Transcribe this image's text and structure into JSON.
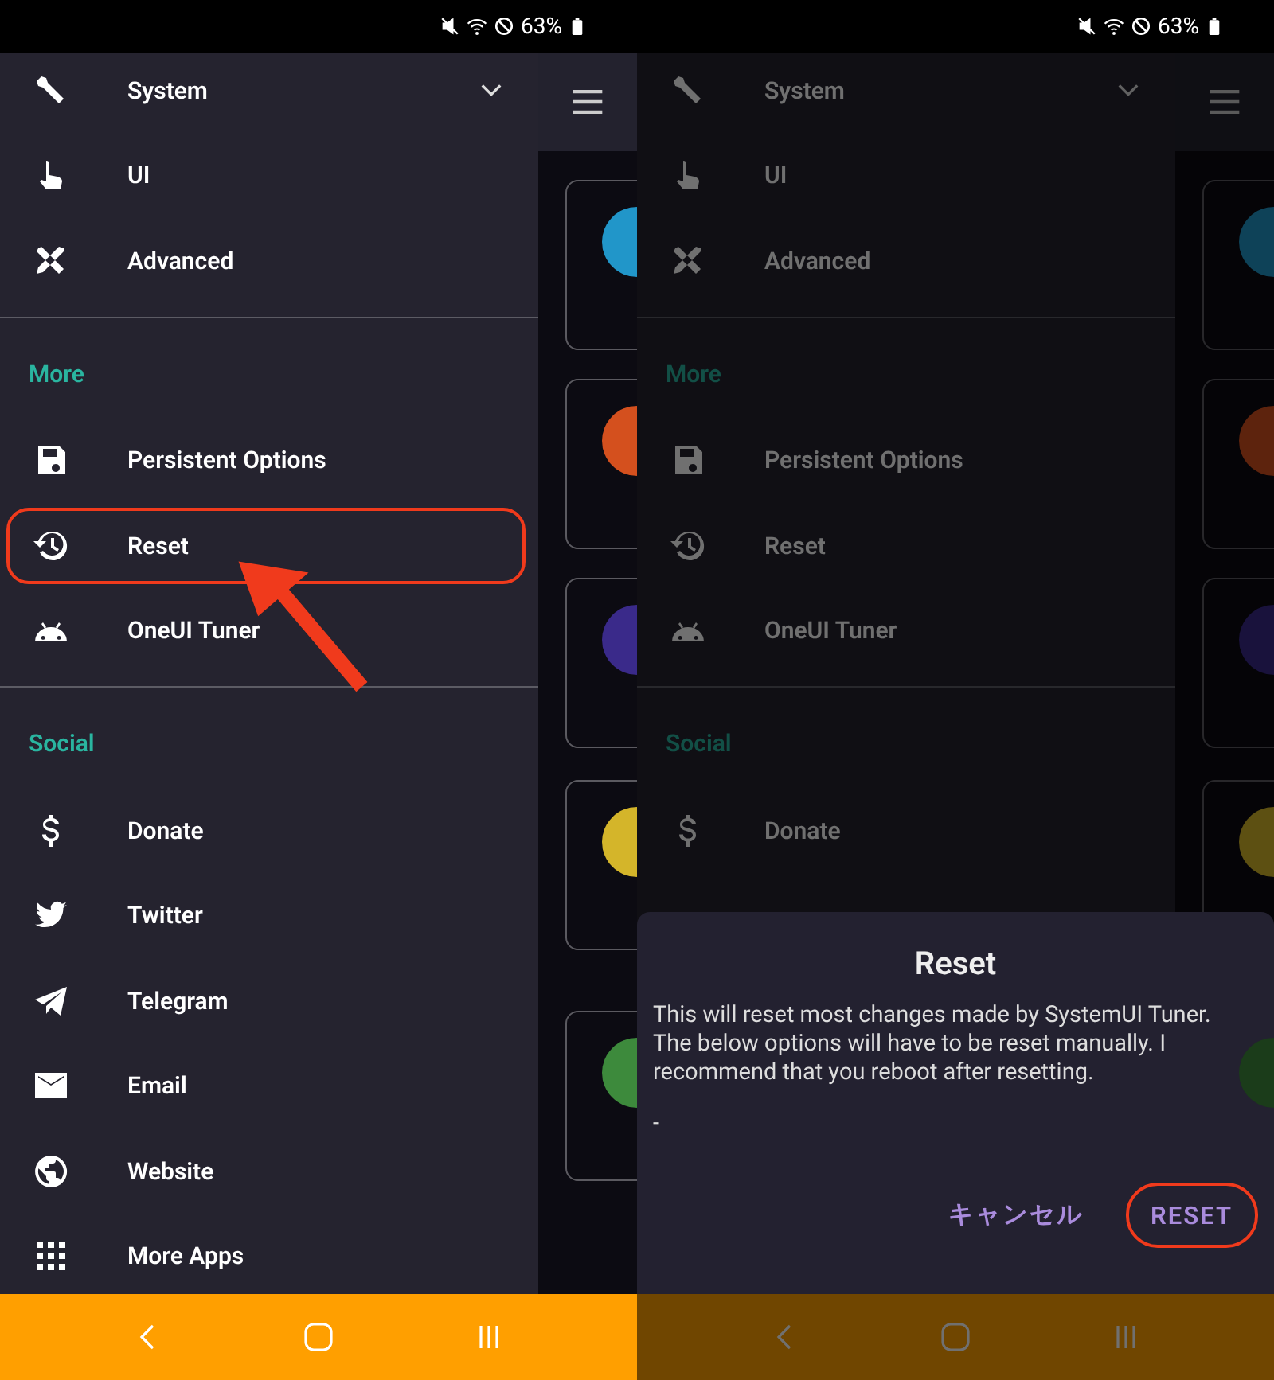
{
  "screens": [
    {
      "status": {
        "battery": "63%"
      },
      "cards": [
        {
          "color": "#2196c9"
        },
        {
          "color": "#d4501e"
        },
        {
          "color": "#3a2a8a"
        },
        {
          "color": "#d4b52a"
        },
        {
          "color": "#3d8a3c"
        }
      ],
      "drawer": {
        "sections": [
          {
            "items": [
              {
                "kind": "wrench",
                "label": "System",
                "expandable": true,
                "highlighted": false
              },
              {
                "kind": "hand",
                "label": "UI",
                "expandable": false,
                "highlighted": false
              },
              {
                "kind": "tools",
                "label": "Advanced",
                "expandable": false,
                "highlighted": false
              }
            ]
          },
          {
            "header": "More",
            "items": [
              {
                "kind": "floppy",
                "label": "Persistent Options",
                "expandable": false,
                "highlighted": false
              },
              {
                "kind": "history",
                "label": "Reset",
                "expandable": false,
                "highlighted": true
              },
              {
                "kind": "android",
                "label": "OneUI Tuner",
                "expandable": false,
                "highlighted": false
              }
            ]
          },
          {
            "header": "Social",
            "items": [
              {
                "kind": "dollar",
                "label": "Donate",
                "expandable": false,
                "highlighted": false
              },
              {
                "kind": "bird",
                "label": "Twitter",
                "expandable": false,
                "highlighted": false
              },
              {
                "kind": "plane",
                "label": "Telegram",
                "expandable": false,
                "highlighted": false
              },
              {
                "kind": "mail",
                "label": "Email",
                "expandable": false,
                "highlighted": false
              },
              {
                "kind": "globe",
                "label": "Website",
                "expandable": false,
                "highlighted": false
              },
              {
                "kind": "grid",
                "label": "More Apps",
                "expandable": false,
                "highlighted": false
              }
            ]
          }
        ]
      },
      "pointer_arrow": true,
      "dimmed": false
    },
    {
      "status": {
        "battery": "63%"
      },
      "cards": [
        {
          "color": "#0e4258"
        },
        {
          "color": "#5d230d"
        },
        {
          "color": "#19123c"
        },
        {
          "color": "#5d5012"
        },
        {
          "color": "#1b3c1a"
        }
      ],
      "drawer": {
        "sections": [
          {
            "items": [
              {
                "kind": "wrench",
                "label": "System",
                "expandable": true,
                "highlighted": false
              },
              {
                "kind": "hand",
                "label": "UI",
                "expandable": false,
                "highlighted": false
              },
              {
                "kind": "tools",
                "label": "Advanced",
                "expandable": false,
                "highlighted": false
              }
            ]
          },
          {
            "header": "More",
            "items": [
              {
                "kind": "floppy",
                "label": "Persistent Options",
                "expandable": false,
                "highlighted": false
              },
              {
                "kind": "history",
                "label": "Reset",
                "expandable": false,
                "highlighted": false
              },
              {
                "kind": "android",
                "label": "OneUI Tuner",
                "expandable": false,
                "highlighted": false
              }
            ]
          },
          {
            "header": "Social",
            "items": [
              {
                "kind": "dollar",
                "label": "Donate",
                "expandable": false,
                "highlighted": false
              }
            ]
          }
        ]
      },
      "pointer_arrow": false,
      "dimmed": true,
      "dialog": {
        "title": "Reset",
        "message": "This will reset most changes made by SystemUI Tuner. The below options will have to be reset manually. I recommend that you reboot after resetting.",
        "detail": "-",
        "buttons": [
          {
            "label": "キャンセル",
            "highlighted": false
          },
          {
            "label": "RESET",
            "highlighted": true
          }
        ]
      }
    }
  ]
}
